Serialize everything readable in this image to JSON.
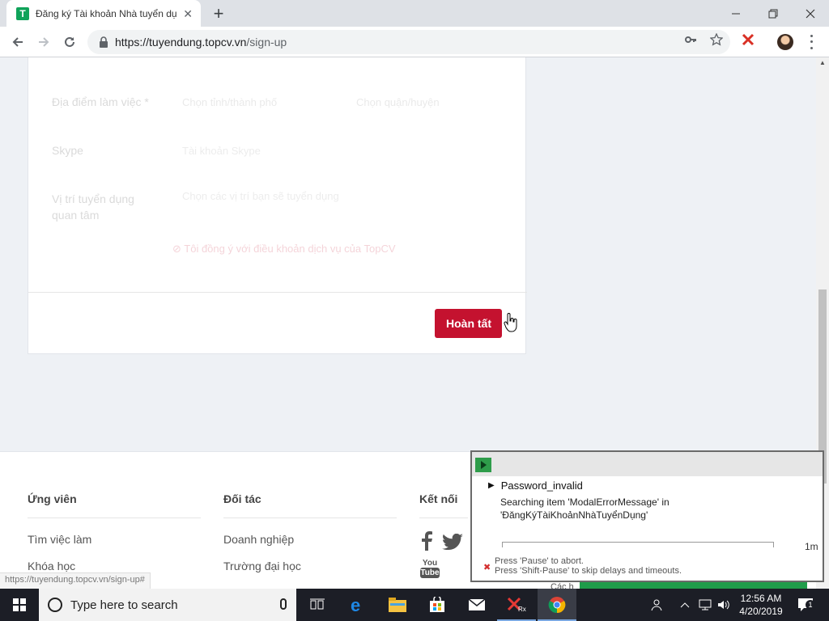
{
  "browser": {
    "tab_title": "Đăng ký Tài khoản Nhà tuyển dụ",
    "favicon_letter": "T",
    "url_host": "https://tuyendung.topcv.vn",
    "url_path": "/sign-up",
    "status_url": "https://tuyendung.topcv.vn/sign-up#"
  },
  "form": {
    "location_label": "Địa điểm làm việc *",
    "location_city": "Chọn tỉnh/thành phố",
    "location_district": "Chọn quận/huyện",
    "skype_label": "Skype",
    "skype_placeholder": "Tài khoản Skype",
    "position_label": "Vị trí tuyển dụng quan tâm",
    "position_placeholder": "Chọn các vị trí bạn sẽ tuyển dụng",
    "terms_prefix": "Tôi đồng ý với",
    "terms_link": "điều khoản dịch",
    "terms_suffix": "vụ của TopCV",
    "submit_label": "Hoàn tất"
  },
  "footer": {
    "candidate": {
      "title": "Ứng viên",
      "links": [
        "Tìm việc làm",
        "Khóa học"
      ]
    },
    "partner": {
      "title": "Đối tác",
      "links": [
        "Doanh nghiệp",
        "Trường đại học"
      ]
    },
    "connect": {
      "title": "Kết nối",
      "youtube_top": "You",
      "youtube_bottom": "Tube"
    }
  },
  "runner": {
    "test_name": "Password_invalid",
    "status_line1": "Searching item 'ModalErrorMessage' in",
    "status_line2": "'ĐăngKýTàiKhoảnNhàTuyểnDụng'",
    "time": "1m",
    "hint_line1": "Press 'Pause' to abort.",
    "hint_line2": "Press 'Shift-Pause' to skip delays and timeouts.",
    "partial_text": "Các h"
  },
  "taskbar": {
    "search_placeholder": "Type here to search",
    "time": "12:56 AM",
    "date": "4/20/2019",
    "notification_count": "1"
  },
  "colors": {
    "brand_red": "#c4122f",
    "runner_green": "#2e9c4a"
  }
}
